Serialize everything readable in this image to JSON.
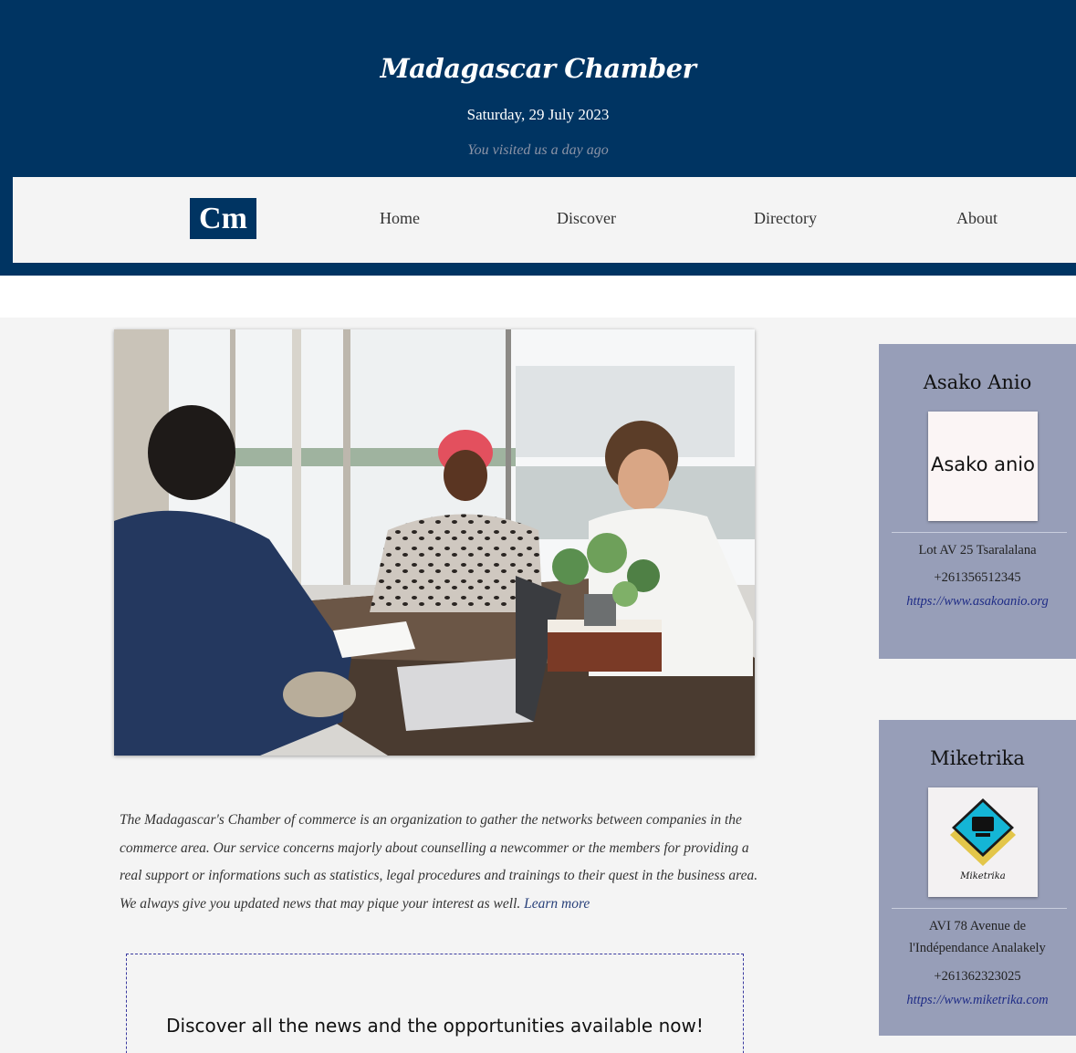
{
  "header": {
    "title": "Madagascar Chamber",
    "date": "Saturday, 29 July 2023",
    "visit_note": "You visited us a day ago"
  },
  "nav": {
    "logo_text": "Cm",
    "items": [
      {
        "label": "Home"
      },
      {
        "label": "Discover"
      },
      {
        "label": "Directory"
      },
      {
        "label": "About"
      }
    ]
  },
  "main": {
    "intro_text": "The Madagascar's Chamber of commerce is an organization to gather the networks between companies in the commerce area. Our service concerns majorly about counselling a newcommer or the members for providing a real support or informations such as statistics, legal procedures and trainings to their quest in the business area. We always give you updated news that may pique your interest as well.",
    "learn_more": "Learn more",
    "cta_text": "Discover all the news and the opportunities available now!"
  },
  "sidebar": {
    "cards": [
      {
        "name": "Asako Anio",
        "logo_text": "Asako anio",
        "address_lines": [
          "Lot AV 25 Tsaralalana"
        ],
        "phone": "+261356512345",
        "website": "https://www.asakoanio.org"
      },
      {
        "name": "Miketrika",
        "logo_text": "Miketrika",
        "address_lines": [
          "AVI 78 Avenue de",
          "l'Indépendance Analakely"
        ],
        "phone": "+261362323025",
        "website": "https://www.miketrika.com"
      }
    ]
  },
  "colors": {
    "header_bg": "#003462",
    "nav_bg": "#f4f4f4",
    "card_bg": "#979eb8",
    "link": "#1f2c86"
  }
}
